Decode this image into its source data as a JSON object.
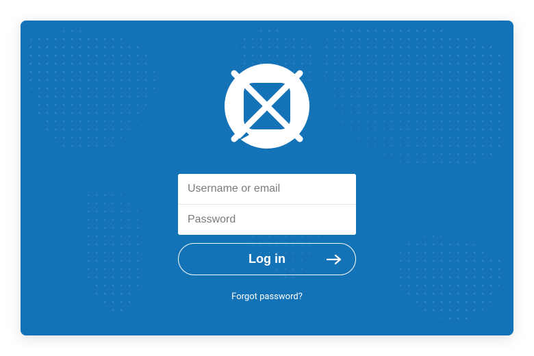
{
  "login": {
    "username_placeholder": "Username or email",
    "password_placeholder": "Password",
    "submit_label": "Log in",
    "forgot_label": "Forgot password?"
  },
  "colors": {
    "panel_bg": "#1473b7",
    "accent": "#ffffff"
  }
}
